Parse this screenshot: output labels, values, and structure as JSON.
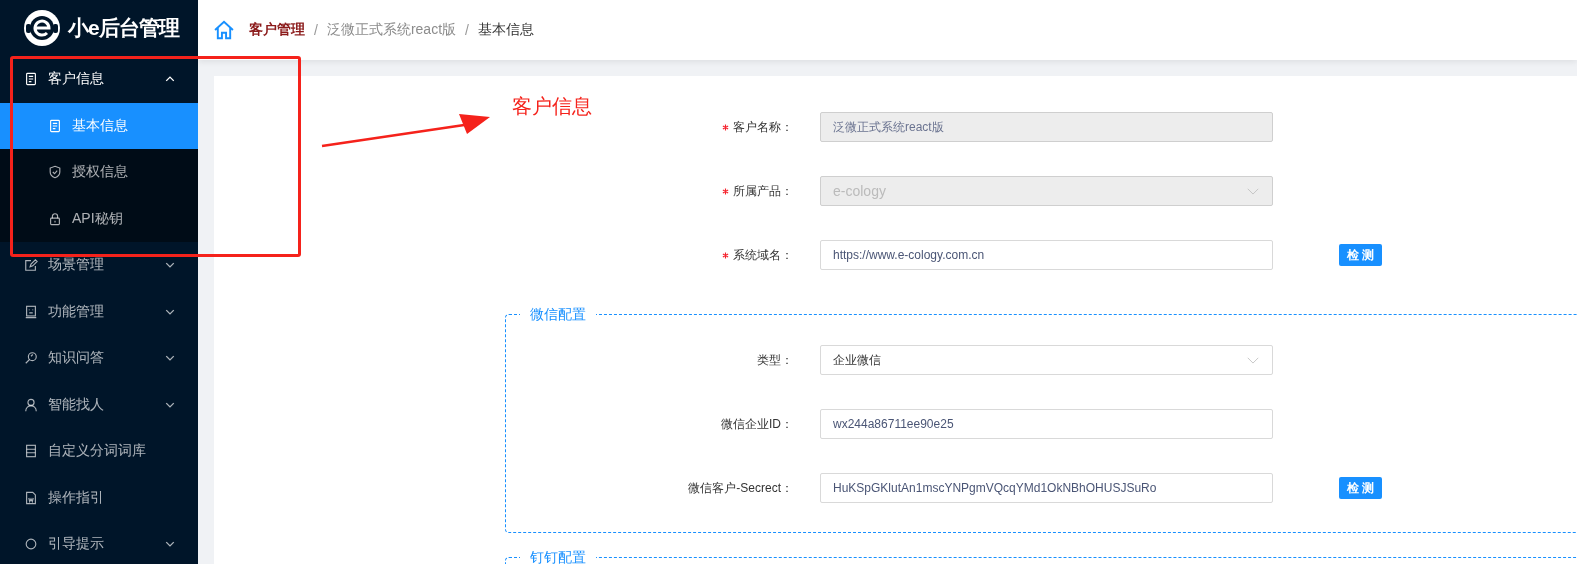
{
  "logo": {
    "text": "小e后台管理"
  },
  "breadcrumb": {
    "items": [
      {
        "label": "客户管理",
        "kind": "link"
      },
      {
        "label": "泛微正式系统react版",
        "kind": "link"
      },
      {
        "label": "基本信息",
        "kind": "current"
      }
    ],
    "separators": [
      "/",
      "/"
    ]
  },
  "sidebar": {
    "items": [
      {
        "label": "客户信息",
        "kind": "submenu",
        "expanded": true,
        "children": [
          {
            "label": "基本信息",
            "selected": true
          },
          {
            "label": "授权信息",
            "selected": false
          },
          {
            "label": "API秘钥",
            "selected": false
          }
        ]
      },
      {
        "label": "场景管理",
        "kind": "submenu",
        "expanded": false
      },
      {
        "label": "功能管理",
        "kind": "submenu",
        "expanded": false
      },
      {
        "label": "知识问答",
        "kind": "submenu",
        "expanded": false
      },
      {
        "label": "智能找人",
        "kind": "submenu",
        "expanded": false
      },
      {
        "label": "自定义分词词库",
        "kind": "item"
      },
      {
        "label": "操作指引",
        "kind": "item"
      },
      {
        "label": "引导提示",
        "kind": "submenu",
        "expanded": false
      }
    ]
  },
  "form": {
    "fields": [
      {
        "label": "客户名称：",
        "required": true,
        "kind": "input",
        "value": "泛微正式系统react版",
        "disabled": true
      },
      {
        "label": "所属产品：",
        "required": true,
        "kind": "select",
        "value": "e-cology",
        "disabled": true
      },
      {
        "label": "系统域名：",
        "required": true,
        "kind": "input",
        "value": "https://www.e-cology.com.cn",
        "disabled": false,
        "button": "检测"
      }
    ],
    "sections": [
      {
        "title": "微信配置",
        "fields": [
          {
            "label": "类型：",
            "required": false,
            "kind": "select",
            "value": "企业微信",
            "disabled": false
          },
          {
            "label": "微信企业ID：",
            "required": false,
            "kind": "input",
            "value": "wx244a86711ee90e25",
            "disabled": false
          },
          {
            "label": "微信客户-Secrect：",
            "required": false,
            "kind": "input",
            "value": "HuKSpGKlutAn1mscYNPgmVQcqYMd1OkNBhOHUSJSuRo",
            "disabled": false,
            "button": "检测"
          }
        ]
      },
      {
        "title": "钉钉配置"
      }
    ]
  },
  "annotation": {
    "label": "客户信息"
  }
}
